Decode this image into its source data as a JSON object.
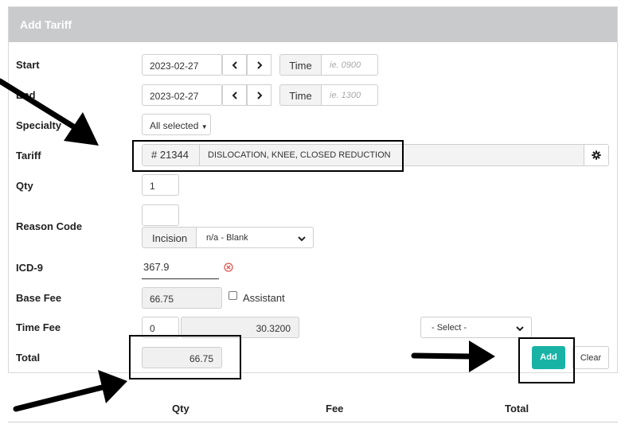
{
  "panel": {
    "title": "Add Tariff"
  },
  "labels": {
    "start": "Start",
    "end": "End",
    "specialty": "Specialty",
    "tariff": "Tariff",
    "qty": "Qty",
    "reason_code": "Reason Code",
    "icd9": "ICD-9",
    "base_fee": "Base Fee",
    "time_fee": "Time Fee",
    "total": "Total"
  },
  "start": {
    "date": "2023-02-27",
    "time_label": "Time",
    "time_placeholder": "ie. 0900"
  },
  "end": {
    "date": "2023-02-27",
    "time_label": "Time",
    "time_placeholder": "ie. 1300"
  },
  "specialty": {
    "selected": "All selected"
  },
  "tariff": {
    "code": "# 21344",
    "description": "DISLOCATION, KNEE, CLOSED REDUCTION"
  },
  "qty": {
    "value": "1"
  },
  "reason_code": {
    "value": "",
    "category": "Incision",
    "selected": "n/a - Blank"
  },
  "icd9": {
    "value": "367.9"
  },
  "base_fee": {
    "value": "66.75",
    "assistant_label": "Assistant",
    "assistant_checked": false
  },
  "time_fee": {
    "units": "0",
    "amount": "30.3200",
    "select_value": "- Select -"
  },
  "total": {
    "value": "66.75"
  },
  "buttons": {
    "add": "Add",
    "clear": "Clear"
  },
  "table_headers": [
    "Qty",
    "Fee",
    "Total"
  ],
  "colors": {
    "header_bg": "#c8cacc",
    "accent": "#19b3a6",
    "error": "#d9534f"
  }
}
